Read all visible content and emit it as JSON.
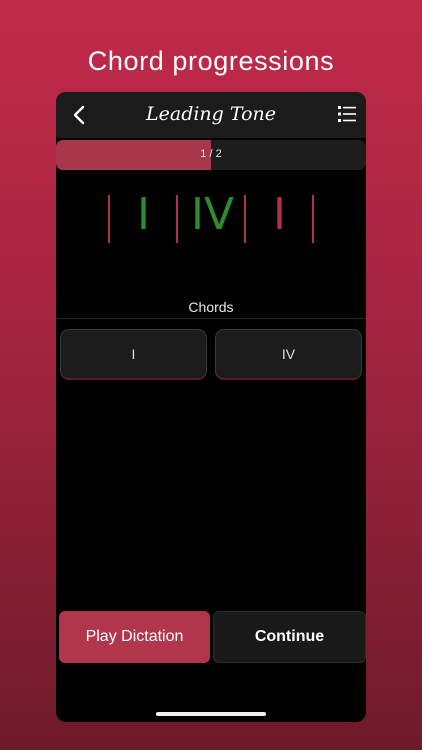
{
  "promo": {
    "title": "Chord progressions"
  },
  "nav": {
    "title": "Leading Tone",
    "back_icon": "chevron-left-icon",
    "menu_icon": "list-icon"
  },
  "progress": {
    "text": "1 / 2",
    "fraction": 0.5,
    "color": "#a8374b"
  },
  "progression": [
    {
      "numeral": "I",
      "color": "#2e8b2e"
    },
    {
      "numeral": "IV",
      "color": "#2e8b2e"
    },
    {
      "numeral": "I",
      "color": "#b23049"
    }
  ],
  "chords": {
    "label": "Chords",
    "options": [
      "I",
      "IV"
    ]
  },
  "actions": {
    "play_label": "Play Dictation",
    "continue_label": "Continue"
  },
  "colors": {
    "accent": "#b1364b",
    "correct": "#2e8b2e",
    "background_top": "#c12a4a"
  }
}
